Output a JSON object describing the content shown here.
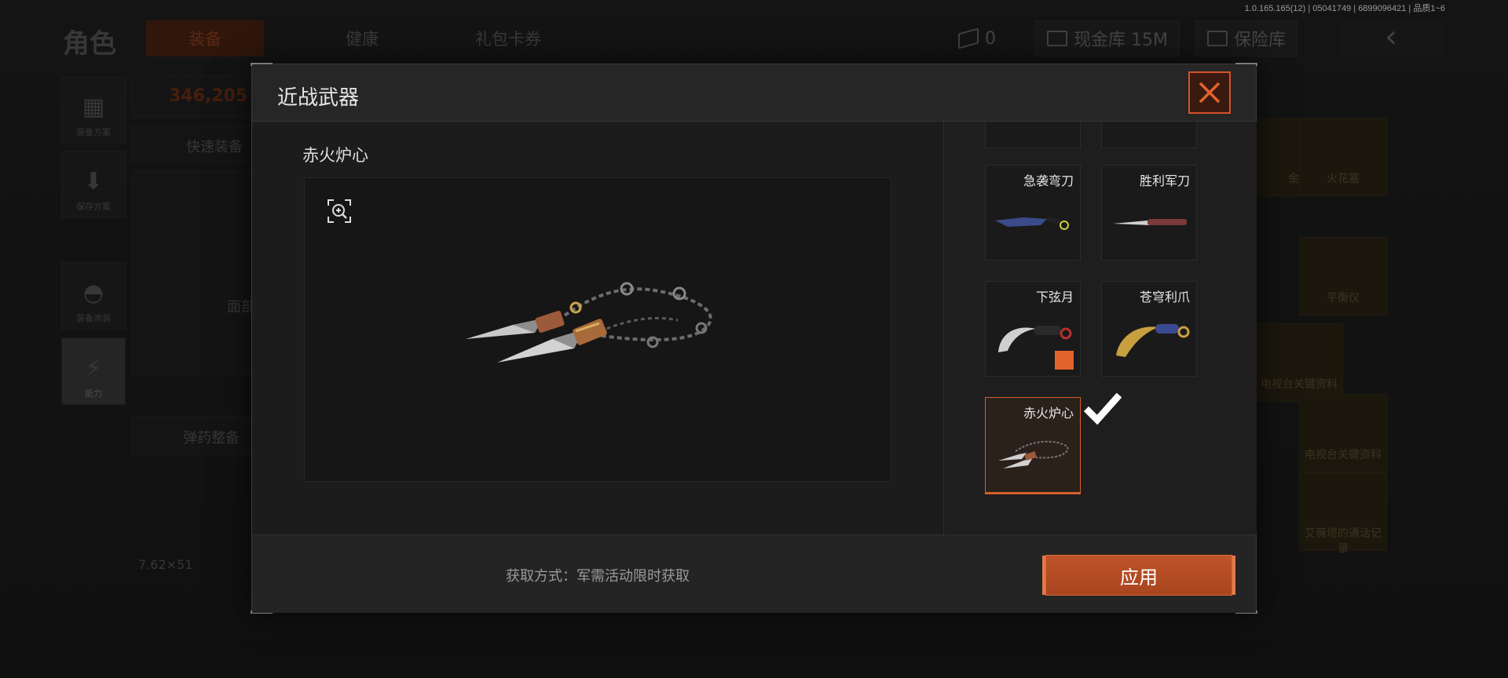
{
  "version_text": "1.0.165.165(12) | 05041749 | 6899096421 | 品质1~6",
  "background": {
    "title": "角色",
    "tabs": [
      "装备",
      "健康",
      "礼包卡券"
    ],
    "ticket_count": "0",
    "cash_label": "现金库 15M",
    "safe_label": "保险库",
    "side_buttons": [
      "装备方案",
      "保存方案",
      "装备涂装",
      "能力"
    ],
    "value": "346,205",
    "quick_equip": "快速装备",
    "ammo": "弹药整备",
    "caliber": "7.62×51",
    "face_label": "面部",
    "right_cards": [
      "金龙",
      "火花塞",
      "平衡仪",
      "电视台关键资料",
      "电视台关键资料",
      "艾薇塔的通话记录"
    ]
  },
  "modal": {
    "title": "近战武器",
    "selected_item_name": "赤火炉心",
    "acquire_text": "获取方式：军需活动限时获取",
    "apply_label": "应用",
    "items": [
      {
        "name": "急袭弯刀",
        "selected": false,
        "equipped": false
      },
      {
        "name": "胜利军刀",
        "selected": false,
        "equipped": false
      },
      {
        "name": "下弦月",
        "selected": false,
        "equipped": true
      },
      {
        "name": "苍穹利爪",
        "selected": false,
        "equipped": false
      },
      {
        "name": "赤火炉心",
        "selected": true,
        "equipped": false
      }
    ],
    "colors": {
      "accent": "#d4602c",
      "button": "#b44c24"
    }
  }
}
